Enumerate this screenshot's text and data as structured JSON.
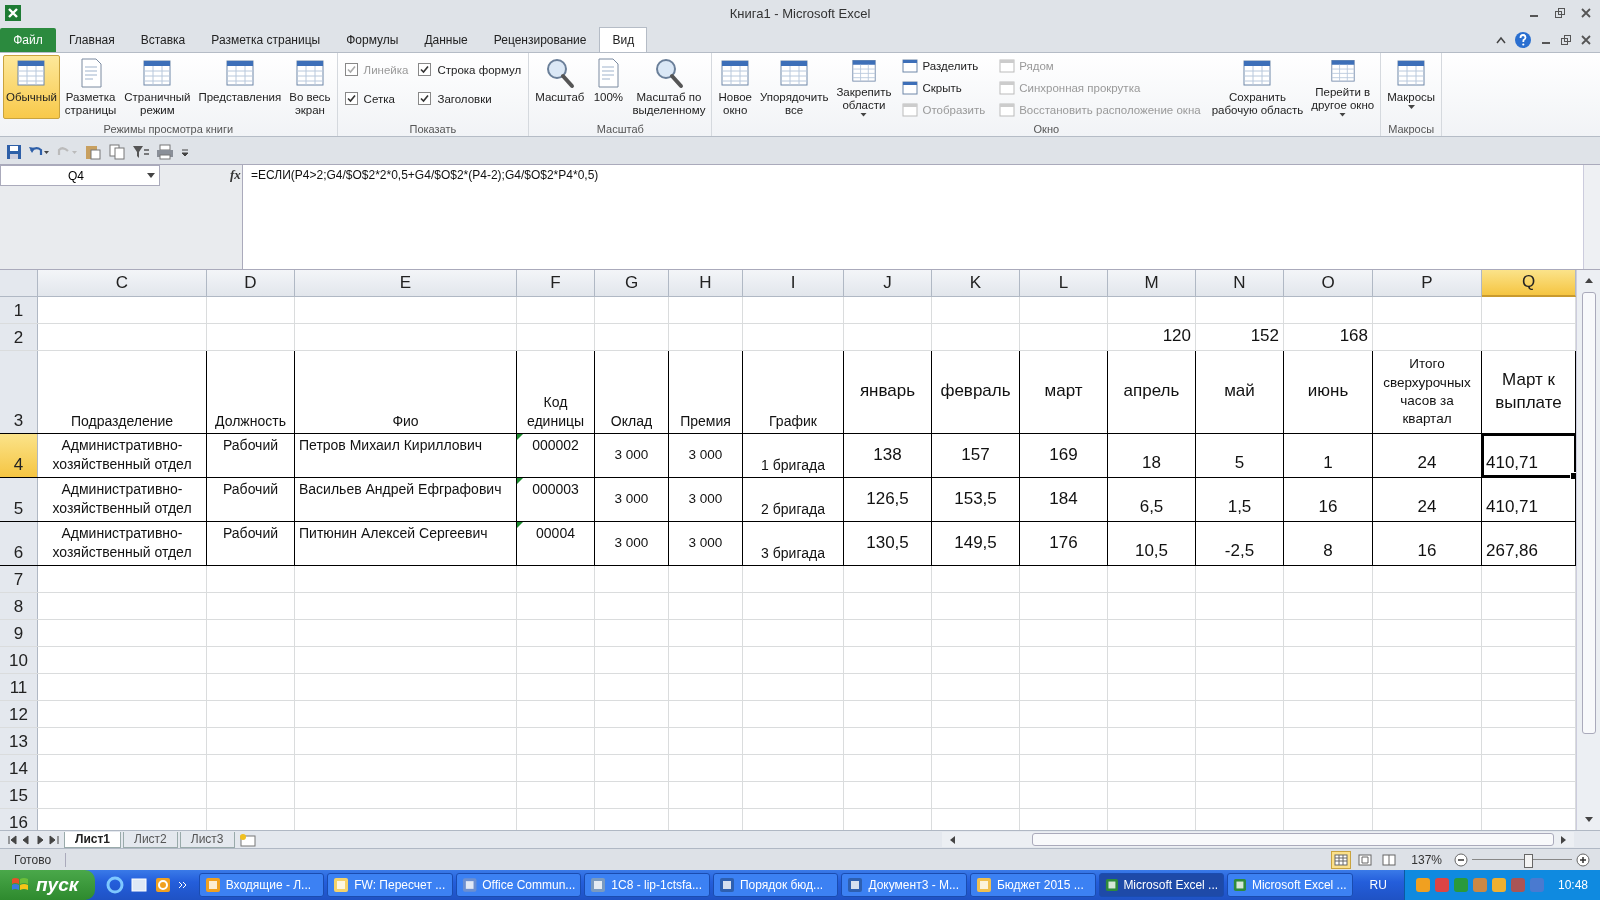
{
  "window": {
    "title": "Книга1  -  Microsoft Excel"
  },
  "file_tab": {
    "label": "Файл"
  },
  "ribbon_tabs": [
    {
      "label": "Главная",
      "selected": false
    },
    {
      "label": "Вставка",
      "selected": false
    },
    {
      "label": "Разметка страницы",
      "selected": false
    },
    {
      "label": "Формулы",
      "selected": false
    },
    {
      "label": "Данные",
      "selected": false
    },
    {
      "label": "Рецензирование",
      "selected": false
    },
    {
      "label": "Вид",
      "selected": true
    }
  ],
  "ribbon": {
    "groups": [
      {
        "label": "Режимы просмотра книги",
        "items": [
          {
            "kind": "large",
            "label": "Обычный",
            "selected": true
          },
          {
            "kind": "large",
            "label": "Разметка\nстраницы",
            "selected": false
          },
          {
            "kind": "large",
            "label": "Страничный\nрежим",
            "selected": false
          },
          {
            "kind": "large",
            "label": "Представления",
            "selected": false
          },
          {
            "kind": "large",
            "label": "Во весь\nэкран",
            "selected": false
          }
        ]
      },
      {
        "label": "Показать",
        "items": [
          {
            "kind": "stack",
            "items": [
              {
                "kind": "check",
                "label": "Линейка",
                "checked": true,
                "disabled": true
              },
              {
                "kind": "check",
                "label": "Сетка",
                "checked": true,
                "disabled": false
              }
            ]
          },
          {
            "kind": "stack",
            "items": [
              {
                "kind": "check",
                "label": "Строка формул",
                "checked": true,
                "disabled": false
              },
              {
                "kind": "check",
                "label": "Заголовки",
                "checked": true,
                "disabled": false
              }
            ]
          }
        ]
      },
      {
        "label": "Масштаб",
        "items": [
          {
            "kind": "large",
            "label": "Масштаб",
            "selected": false
          },
          {
            "kind": "large",
            "label": "100%",
            "selected": false
          },
          {
            "kind": "large",
            "label": "Масштаб по\nвыделенному",
            "selected": false
          }
        ]
      },
      {
        "label": "Окно",
        "items": [
          {
            "kind": "large",
            "label": "Новое\nокно",
            "selected": false
          },
          {
            "kind": "large",
            "label": "Упорядочить\nвсе",
            "selected": false
          },
          {
            "kind": "large",
            "label": "Закрепить\nобласти",
            "selected": false,
            "dropdown": true
          },
          {
            "kind": "stack",
            "items": [
              {
                "kind": "small",
                "label": "Разделить",
                "disabled": false
              },
              {
                "kind": "small",
                "label": "Скрыть",
                "disabled": false
              },
              {
                "kind": "small",
                "label": "Отобразить",
                "disabled": true
              }
            ]
          },
          {
            "kind": "stack",
            "items": [
              {
                "kind": "small",
                "label": "Рядом",
                "disabled": true
              },
              {
                "kind": "small",
                "label": "Синхронная прокрутка",
                "disabled": true
              },
              {
                "kind": "small",
                "label": "Восстановить расположение окна",
                "disabled": true
              }
            ]
          },
          {
            "kind": "large",
            "label": "Сохранить\nрабочую область",
            "selected": false
          },
          {
            "kind": "large",
            "label": "Перейти в\nдругое окно",
            "selected": false,
            "dropdown": true
          }
        ]
      },
      {
        "label": "Макросы",
        "items": [
          {
            "kind": "large",
            "label": "Макросы",
            "selected": false,
            "dropdown": true
          }
        ]
      }
    ]
  },
  "formula_bar": {
    "name_box": "Q4",
    "function_label": "fx",
    "formula": "=ЕСЛИ(P4>2;G4/$O$2*2*0,5+G4/$O$2*(P4-2);G4/$O$2*P4*0,5)"
  },
  "sheet": {
    "columns": [
      {
        "label": "C",
        "selected": false
      },
      {
        "label": "D",
        "selected": false
      },
      {
        "label": "E",
        "selected": false
      },
      {
        "label": "F",
        "selected": false
      },
      {
        "label": "G",
        "selected": false
      },
      {
        "label": "H",
        "selected": false
      },
      {
        "label": "I",
        "selected": false
      },
      {
        "label": "J",
        "selected": false
      },
      {
        "label": "K",
        "selected": false
      },
      {
        "label": "L",
        "selected": false
      },
      {
        "label": "M",
        "selected": false
      },
      {
        "label": "N",
        "selected": false
      },
      {
        "label": "O",
        "selected": false
      },
      {
        "label": "P",
        "selected": false
      },
      {
        "label": "Q",
        "selected": true
      }
    ],
    "rows": [
      {
        "number": "1",
        "kind": "plain",
        "selected": false
      },
      {
        "number": "2",
        "kind": "plain",
        "selected": false,
        "cells": {
          "M": "120",
          "N": "152",
          "O": "168"
        }
      },
      {
        "number": "3",
        "kind": "header",
        "selected": false,
        "cells": {
          "C": "Подразделение",
          "D": "Должность",
          "E": "Фио",
          "F": "Код единицы",
          "G": "Оклад",
          "H": "Премия",
          "I": "График",
          "J": "январь",
          "K": "февраль",
          "L": "март",
          "M": "апрель",
          "N": "май",
          "O": "июнь",
          "P": "Итого сверхурочных часов за квартал",
          "Q": "Март к выплате"
        }
      },
      {
        "number": "4",
        "kind": "data",
        "selected": true,
        "cells": {
          "C": "Административно-хозяйственный отдел",
          "D": "Рабочий",
          "E": "Петров Михаил Кириллович",
          "F": {
            "text": "000002",
            "error_flag": true
          },
          "G": "3 000",
          "H": "3 000",
          "I": "1 бригада",
          "J": "138",
          "K": "157",
          "L": "169",
          "M": "18",
          "N": "5",
          "O": "1",
          "P": "24",
          "Q": "410,71"
        }
      },
      {
        "number": "5",
        "kind": "data",
        "selected": false,
        "cells": {
          "C": "Административно-хозяйственный отдел",
          "D": "Рабочий",
          "E": "Васильев Андрей Ефграфович",
          "F": {
            "text": "000003",
            "error_flag": true
          },
          "G": "3 000",
          "H": "3 000",
          "I": "2 бригада",
          "J": "126,5",
          "K": "153,5",
          "L": "184",
          "M": "6,5",
          "N": "1,5",
          "O": "16",
          "P": "24",
          "Q": "410,71"
        }
      },
      {
        "number": "6",
        "kind": "data",
        "selected": false,
        "cells": {
          "C": "Административно-хозяйственный отдел",
          "D": "Рабочий",
          "E": "Питюнин Алексей Сергеевич",
          "F": {
            "text": "00004",
            "error_flag": true
          },
          "G": "3 000",
          "H": "3 000",
          "I": "3 бригада",
          "J": "130,5",
          "K": "149,5",
          "L": "176",
          "M": "10,5",
          "N": "-2,5",
          "O": "8",
          "P": "16",
          "Q": "267,86"
        }
      },
      {
        "number": "7",
        "kind": "plain",
        "selected": false
      },
      {
        "number": "8",
        "kind": "plain",
        "selected": false
      },
      {
        "number": "9",
        "kind": "plain",
        "selected": false
      },
      {
        "number": "10",
        "kind": "plain",
        "selected": false
      },
      {
        "number": "11",
        "kind": "plain",
        "selected": false
      },
      {
        "number": "12",
        "kind": "plain",
        "selected": false
      },
      {
        "number": "13",
        "kind": "plain",
        "selected": false
      },
      {
        "number": "14",
        "kind": "plain",
        "selected": false
      },
      {
        "number": "15",
        "kind": "plain",
        "selected": false
      },
      {
        "number": "16",
        "kind": "plain",
        "selected": false
      }
    ]
  },
  "sheet_tabs": [
    {
      "label": "Лист1",
      "selected": true
    },
    {
      "label": "Лист2",
      "selected": false
    },
    {
      "label": "Лист3",
      "selected": false
    }
  ],
  "status_bar": {
    "status": "Готово",
    "views": [
      {
        "selected": true
      },
      {
        "selected": false
      },
      {
        "selected": false
      }
    ],
    "zoom": "137%",
    "zoom_slider": {
      "level": 0.55
    }
  },
  "taskbar": {
    "start": "пуск",
    "tasks": [
      {
        "label": "Входящие - Л...",
        "selected": false
      },
      {
        "label": "FW: Пересчет ...",
        "selected": false
      },
      {
        "label": "Office Commun...",
        "selected": false
      },
      {
        "label": "1С8 - lip-1ctsfa...",
        "selected": false
      },
      {
        "label": "Порядок бюд...",
        "selected": false
      },
      {
        "label": "Документ3 - М...",
        "selected": false
      },
      {
        "label": "Бюджет 2015 ...",
        "selected": false
      },
      {
        "label": "Microsoft Excel ...",
        "selected": true
      },
      {
        "label": "Microsoft Excel ...",
        "selected": false
      }
    ],
    "language": "RU",
    "clock": "10:48"
  }
}
